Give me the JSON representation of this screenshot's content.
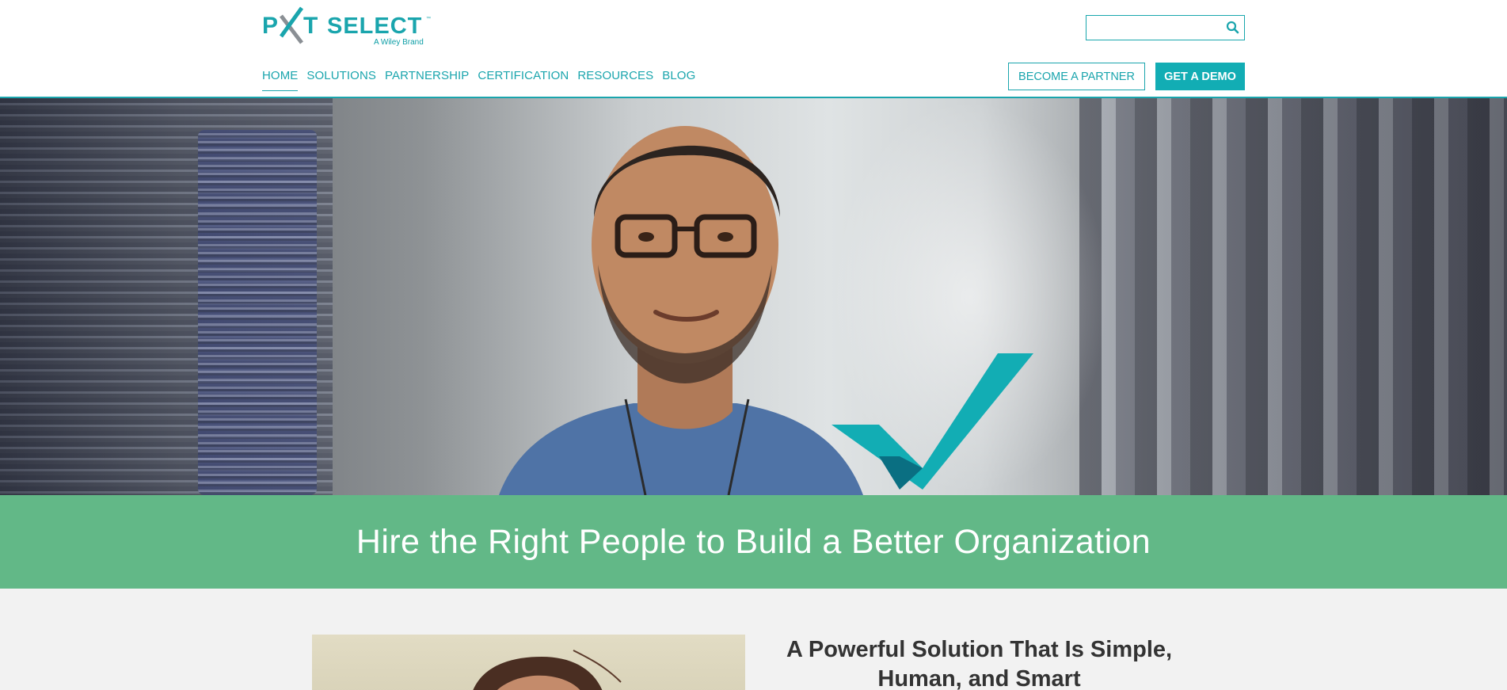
{
  "brand": {
    "name": "PXT SELECT",
    "subtitle": "A Wiley Brand",
    "accent_color": "#1aa5ad",
    "logo_icon": "pxt-select-logo"
  },
  "search": {
    "placeholder": "",
    "value": "",
    "icon": "search-icon"
  },
  "nav": {
    "items": [
      {
        "label": "HOME",
        "active": true
      },
      {
        "label": "SOLUTIONS",
        "active": false
      },
      {
        "label": "PARTNERSHIP",
        "active": false
      },
      {
        "label": "CERTIFICATION",
        "active": false
      },
      {
        "label": "RESOURCES",
        "active": false
      },
      {
        "label": "BLOG",
        "active": false
      }
    ]
  },
  "header_buttons": {
    "partner_label": "BECOME A PARTNER",
    "demo_label": "GET A DEMO"
  },
  "hero": {
    "image": "man-with-glasses-in-server-room-photo",
    "check_icon": "checkmark-icon",
    "check_color": "#12adb4"
  },
  "banner": {
    "headline": "Hire the Right People to Build a Better Organization",
    "background_color": "#62b887"
  },
  "feature": {
    "image": "woman-portrait-photo",
    "title": "A Powerful Solution That Is Simple, Human, and Smart"
  }
}
